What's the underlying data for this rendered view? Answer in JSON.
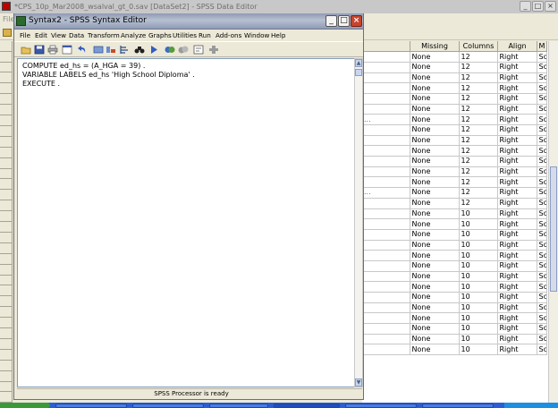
{
  "back_window": {
    "title": "*CPS_10p_Mar2008_wsalval_gt_0.sav [DataSet2] - SPSS Data Editor",
    "menu_first": "File",
    "minimize": "_",
    "maximize": "□",
    "close": "×"
  },
  "grid": {
    "headers": [
      "Missing",
      "Columns",
      "Align",
      "M"
    ],
    "rows": [
      {
        "frag": "",
        "missing": "None",
        "columns": "12",
        "align": "Right",
        "measure": "Sca"
      },
      {
        "frag": "",
        "missing": "None",
        "columns": "12",
        "align": "Right",
        "measure": "Sca"
      },
      {
        "frag": "",
        "missing": "None",
        "columns": "12",
        "align": "Right",
        "measure": "Sca"
      },
      {
        "frag": "",
        "missing": "None",
        "columns": "12",
        "align": "Right",
        "measure": "Sca"
      },
      {
        "frag": "",
        "missing": "None",
        "columns": "12",
        "align": "Right",
        "measure": "Sca"
      },
      {
        "frag": "",
        "missing": "None",
        "columns": "12",
        "align": "Right",
        "measure": "Sca"
      },
      {
        "frag": "...",
        "missing": "None",
        "columns": "12",
        "align": "Right",
        "measure": "Sca"
      },
      {
        "frag": "",
        "missing": "None",
        "columns": "12",
        "align": "Right",
        "measure": "Sca"
      },
      {
        "frag": "",
        "missing": "None",
        "columns": "12",
        "align": "Right",
        "measure": "Sca"
      },
      {
        "frag": "",
        "missing": "None",
        "columns": "12",
        "align": "Right",
        "measure": "Sca"
      },
      {
        "frag": "",
        "missing": "None",
        "columns": "12",
        "align": "Right",
        "measure": "Sca"
      },
      {
        "frag": "",
        "missing": "None",
        "columns": "12",
        "align": "Right",
        "measure": "Sca"
      },
      {
        "frag": "",
        "missing": "None",
        "columns": "12",
        "align": "Right",
        "measure": "Sca"
      },
      {
        "frag": "...",
        "missing": "None",
        "columns": "12",
        "align": "Right",
        "measure": "Sca"
      },
      {
        "frag": "",
        "missing": "None",
        "columns": "12",
        "align": "Right",
        "measure": "Sca"
      },
      {
        "frag": "",
        "missing": "None",
        "columns": "10",
        "align": "Right",
        "measure": "Sca"
      },
      {
        "frag": "",
        "missing": "None",
        "columns": "10",
        "align": "Right",
        "measure": "Sca"
      },
      {
        "frag": "",
        "missing": "None",
        "columns": "10",
        "align": "Right",
        "measure": "Sca"
      },
      {
        "frag": "",
        "missing": "None",
        "columns": "10",
        "align": "Right",
        "measure": "Sca"
      },
      {
        "frag": "",
        "missing": "None",
        "columns": "10",
        "align": "Right",
        "measure": "Sca"
      },
      {
        "frag": "",
        "missing": "None",
        "columns": "10",
        "align": "Right",
        "measure": "Sca"
      },
      {
        "frag": "",
        "missing": "None",
        "columns": "10",
        "align": "Right",
        "measure": "Sca"
      },
      {
        "frag": "",
        "missing": "None",
        "columns": "10",
        "align": "Right",
        "measure": "Sca"
      },
      {
        "frag": "",
        "missing": "None",
        "columns": "10",
        "align": "Right",
        "measure": "Sca"
      },
      {
        "frag": "",
        "missing": "None",
        "columns": "10",
        "align": "Right",
        "measure": "Sca"
      },
      {
        "frag": "",
        "missing": "None",
        "columns": "10",
        "align": "Right",
        "measure": "Sca"
      },
      {
        "frag": "",
        "missing": "None",
        "columns": "10",
        "align": "Right",
        "measure": "Sca"
      },
      {
        "frag": "",
        "missing": "None",
        "columns": "10",
        "align": "Right",
        "measure": "Sca"
      },
      {
        "frag": "",
        "missing": "None",
        "columns": "10",
        "align": "Right",
        "measure": "Sca"
      }
    ]
  },
  "syntax_window": {
    "title": "Syntax2 - SPSS Syntax Editor",
    "minimize": "_",
    "maximize": "□",
    "close": "×",
    "menu": [
      "File",
      "Edit",
      "View",
      "Data",
      "Transform",
      "Analyze",
      "Graphs",
      "Utilities",
      "Run",
      "Add-ons",
      "Window",
      "Help"
    ],
    "toolbar_icons": [
      "open-icon",
      "save-icon",
      "print-icon",
      "dialog-recall-icon",
      "undo-icon",
      "goto-case-icon",
      "variables-icon",
      "find-icon",
      "binoculars-icon",
      "run-icon",
      "syntax-help-icon",
      "bookmark-icon",
      "custom-dialog-icon",
      "add-icon"
    ],
    "lines": [
      "COMPUTE ed_hs = (A_HGA = 39) .",
      "VARIABLE LABELS ed_hs 'High School Diploma' .",
      "EXECUTE ."
    ],
    "status": "SPSS Processor is ready",
    "scroll_up": "▲",
    "scroll_down": "▼"
  },
  "colors": {
    "title_inactive": "#8f9bb3",
    "close_button": "#c9442b",
    "taskbar": "#2a5dd6"
  }
}
